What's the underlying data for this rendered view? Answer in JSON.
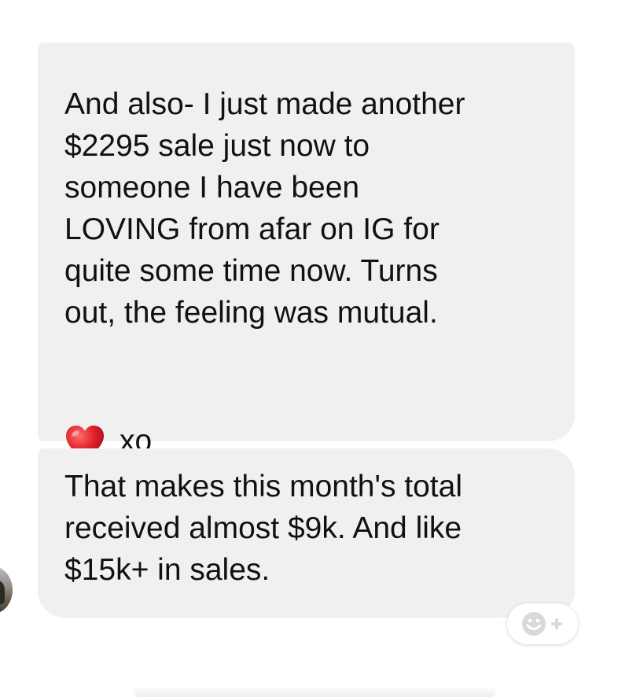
{
  "messages": [
    {
      "text": "And also- I just made another\n$2295 sale just now to\nsomeone I have been\nLOVING from afar on IG for\nquite some time now. Turns\nout, the feeling was mutual.",
      "reaction_icon": "red-heart-emoji",
      "trailing_text": "xo"
    },
    {
      "text": "That makes this month's total\nreceived almost $9k. And like\n$15k+ in sales."
    }
  ],
  "icons": {
    "avatar": "sender-avatar",
    "add_reaction": "smiley-plus-icon"
  },
  "colors": {
    "bubble_bg": "#f0f0f0",
    "text": "#111111",
    "heart": "#e0202a",
    "reaction_icon": "#d9d9d9"
  }
}
